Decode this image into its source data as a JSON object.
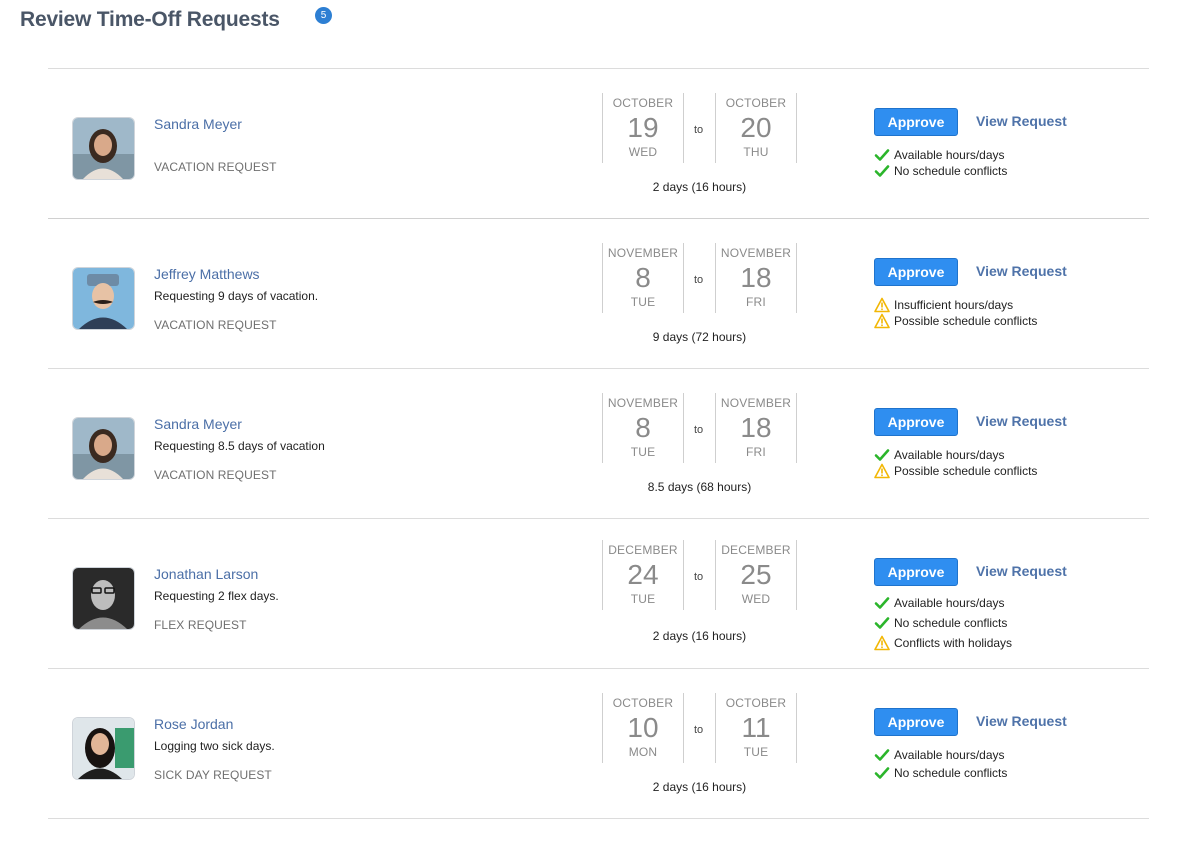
{
  "page": {
    "title": "Review Time-Off Requests",
    "count": "5"
  },
  "requests": [
    {
      "name": "Sandra Meyer",
      "note": "",
      "type": "VACATION REQUEST",
      "from": {
        "month": "OCTOBER",
        "day": "19",
        "dow": "WED"
      },
      "to": {
        "month": "OCTOBER",
        "day": "20",
        "dow": "THU"
      },
      "to_label": "to",
      "duration": "2 days (16 hours)",
      "approve": "Approve",
      "view": "View Request",
      "checks": [
        {
          "icon": "check-icon",
          "text": "Available hours/days"
        },
        {
          "icon": "check-icon",
          "text": "No schedule conflicts"
        }
      ]
    },
    {
      "name": "Jeffrey Matthews",
      "note": "Requesting 9 days of vacation.",
      "type": "VACATION REQUEST",
      "from": {
        "month": "NOVEMBER",
        "day": "8",
        "dow": "TUE"
      },
      "to": {
        "month": "NOVEMBER",
        "day": "18",
        "dow": "FRI"
      },
      "to_label": "to",
      "duration": "9 days (72 hours)",
      "approve": "Approve",
      "view": "View Request",
      "checks": [
        {
          "icon": "warning-icon",
          "text": "Insufficient hours/days"
        },
        {
          "icon": "warning-icon",
          "text": "Possible schedule conflicts"
        }
      ]
    },
    {
      "name": "Sandra Meyer",
      "note": "Requesting 8.5 days of vacation",
      "type": "VACATION REQUEST",
      "from": {
        "month": "NOVEMBER",
        "day": "8",
        "dow": "TUE"
      },
      "to": {
        "month": "NOVEMBER",
        "day": "18",
        "dow": "FRI"
      },
      "to_label": "to",
      "duration": "8.5 days (68 hours)",
      "approve": "Approve",
      "view": "View Request",
      "checks": [
        {
          "icon": "check-icon",
          "text": "Available hours/days"
        },
        {
          "icon": "warning-icon",
          "text": "Possible schedule conflicts"
        }
      ]
    },
    {
      "name": "Jonathan Larson",
      "note": "Requesting 2 flex days.",
      "type": "FLEX REQUEST",
      "from": {
        "month": "DECEMBER",
        "day": "24",
        "dow": "TUE"
      },
      "to": {
        "month": "DECEMBER",
        "day": "25",
        "dow": "WED"
      },
      "to_label": "to",
      "duration": "2 days (16 hours)",
      "approve": "Approve",
      "view": "View Request",
      "checks": [
        {
          "icon": "check-icon",
          "text": "Available hours/days"
        },
        {
          "icon": "check-icon",
          "text": "No schedule conflicts"
        },
        {
          "icon": "warning-icon",
          "text": "Conflicts with holidays"
        }
      ]
    },
    {
      "name": "Rose Jordan",
      "note": "Logging two sick days.",
      "type": "SICK DAY REQUEST",
      "from": {
        "month": "OCTOBER",
        "day": "10",
        "dow": "MON"
      },
      "to": {
        "month": "OCTOBER",
        "day": "11",
        "dow": "TUE"
      },
      "to_label": "to",
      "duration": "2 days (16 hours)",
      "approve": "Approve",
      "view": "View Request",
      "checks": [
        {
          "icon": "check-icon",
          "text": "Available hours/days"
        },
        {
          "icon": "check-icon",
          "text": "No schedule conflicts"
        }
      ]
    }
  ],
  "colors": {
    "accent": "#2f8ef0",
    "link": "#4f73a9",
    "ok": "#2bb52b",
    "warn": "#f2b705",
    "badge": "#2d7fd3"
  }
}
